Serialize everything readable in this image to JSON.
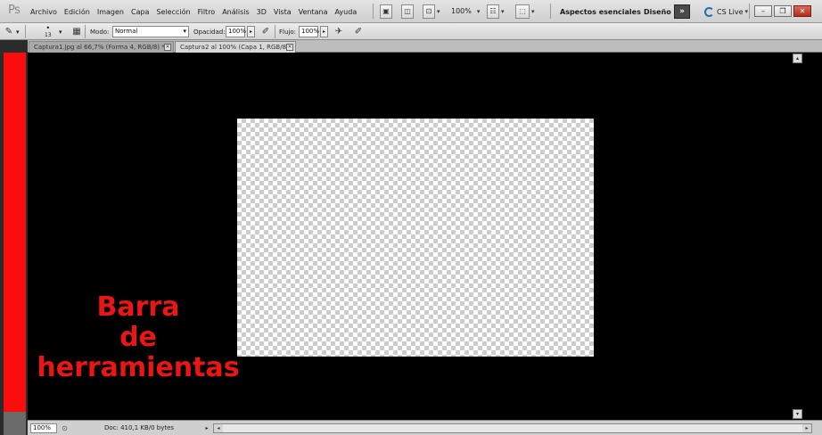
{
  "app": {
    "logo": "Ps"
  },
  "menu": [
    "Archivo",
    "Edición",
    "Imagen",
    "Capa",
    "Selección",
    "Filtro",
    "Análisis",
    "3D",
    "Vista",
    "Ventana",
    "Ayuda"
  ],
  "menubar_tools": {
    "zoom": "100%"
  },
  "workspace": {
    "essentials": "Aspectos esenciales",
    "design": "Diseño",
    "more": "»",
    "cs_live": "CS Live"
  },
  "options": {
    "mode_label": "Modo:",
    "mode_value": "Normal",
    "opacity_label": "Opacidad:",
    "opacity_value": "100%",
    "flow_label": "Flujo:",
    "flow_value": "100%",
    "brush_size": "13"
  },
  "tabs": [
    {
      "label": "Captura1.jpg al 66,7% (Forma 4, RGB/8) *"
    },
    {
      "label": "Captura2 al 100% (Capa 1, RGB/8)"
    }
  ],
  "annotation": {
    "line1": "Barra",
    "line2": "de",
    "line3": "herramientas"
  },
  "status": {
    "zoom": "100%",
    "doc_info": "Doc: 410,1 KB/0 bytes"
  },
  "colors": {
    "annotation_red": "#ea1616",
    "toolbar_red": "#fb0d0d",
    "canvas_bg": "#000000"
  },
  "icons": [
    "brush-icon",
    "toggle-brush-panel-icon",
    "airbrush-icon",
    "tablet-pressure-icon",
    "chevron-right-icon",
    "close-icon"
  ]
}
